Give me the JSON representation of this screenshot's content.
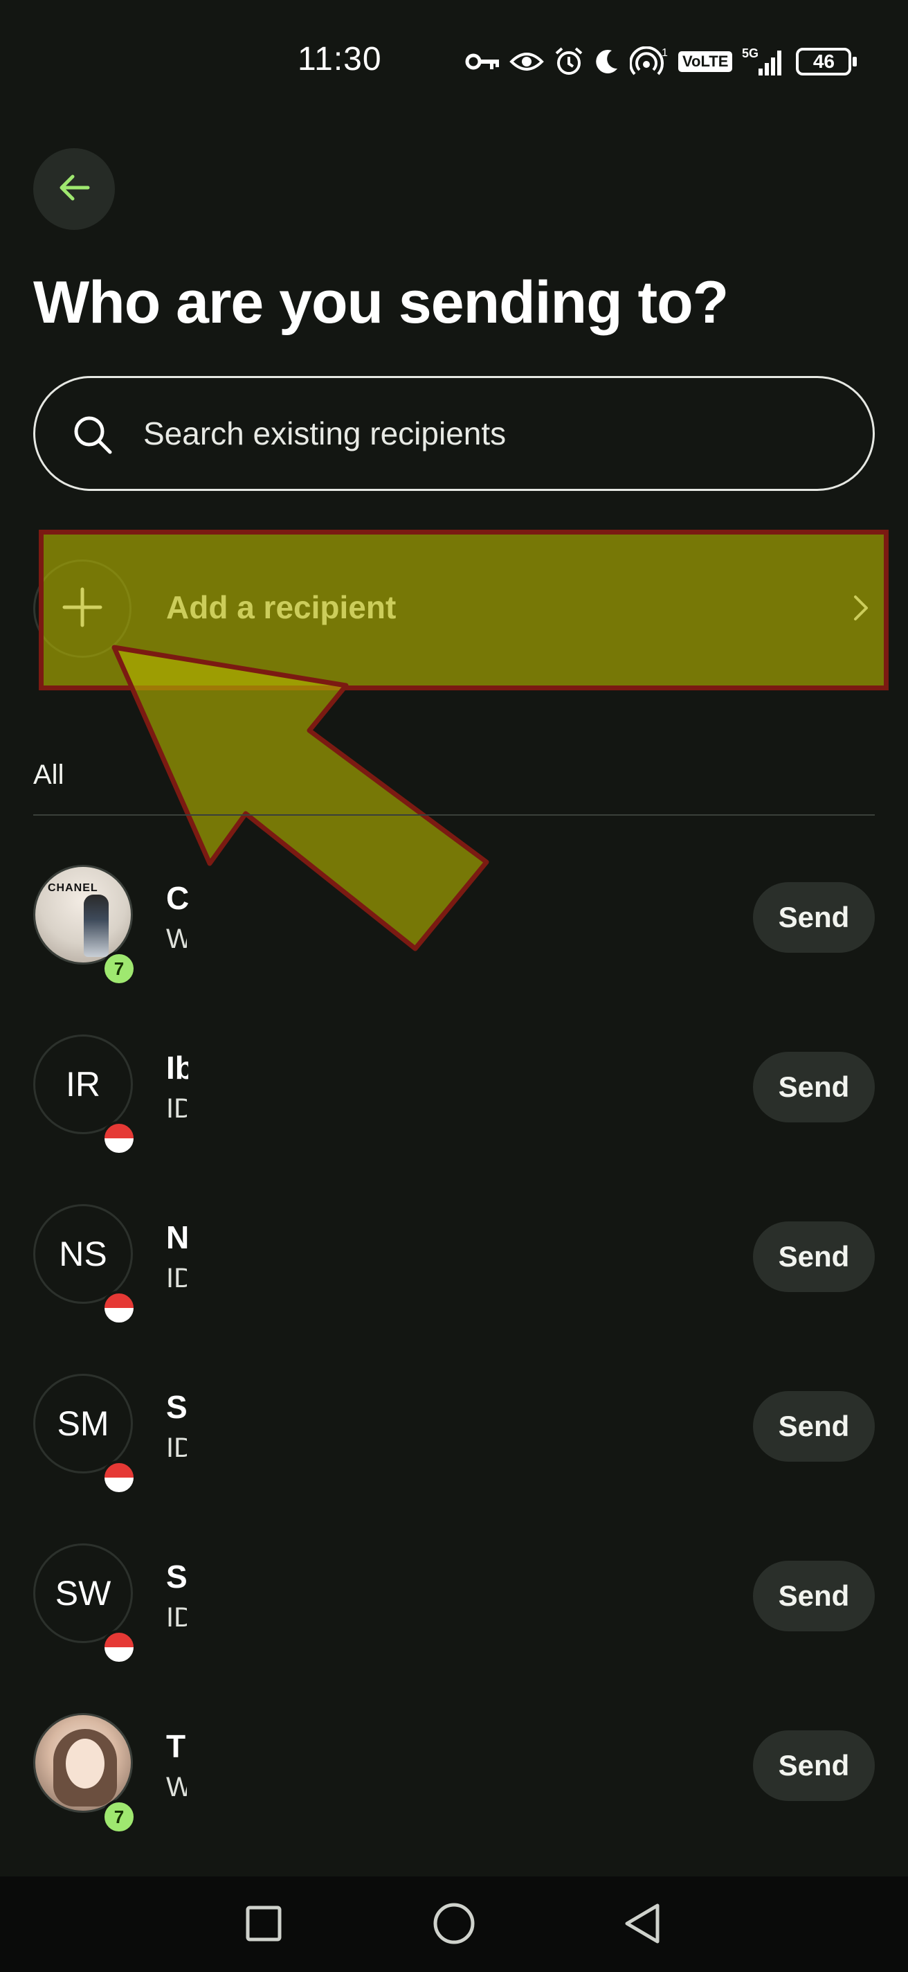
{
  "status_bar": {
    "time": "11:30",
    "signal_superscript": "1",
    "volte": "VoLTE",
    "network": "5G",
    "battery": "46"
  },
  "header": {
    "title": "Who are you sending to?"
  },
  "search": {
    "placeholder": "Search existing recipients"
  },
  "add_recipient": {
    "label": "Add a recipient"
  },
  "list": {
    "section_label": "All",
    "send_label": "Send",
    "recipients": [
      {
        "name": "C",
        "subtitle": "W",
        "avatar_type": "photo",
        "avatar_text": "CHANEL",
        "badge": "wise",
        "badge_text": "7"
      },
      {
        "name": "Ib",
        "subtitle": "ID",
        "avatar_type": "initials",
        "initials": "IR",
        "badge": "flag-id"
      },
      {
        "name": "N",
        "subtitle": "ID",
        "avatar_type": "initials",
        "initials": "NS",
        "badge": "flag-id"
      },
      {
        "name": "S",
        "subtitle": "ID",
        "avatar_type": "initials",
        "initials": "SM",
        "badge": "flag-id"
      },
      {
        "name": "S",
        "subtitle": "ID",
        "avatar_type": "initials",
        "initials": "SW",
        "badge": "flag-id"
      },
      {
        "name": "T",
        "subtitle": "W",
        "avatar_type": "photo2",
        "badge": "wise",
        "badge_text": "7"
      }
    ]
  },
  "colors": {
    "background": "#131612",
    "accent": "#9fe870",
    "highlight": "#b5b500",
    "highlight_border": "#7b1a12"
  }
}
